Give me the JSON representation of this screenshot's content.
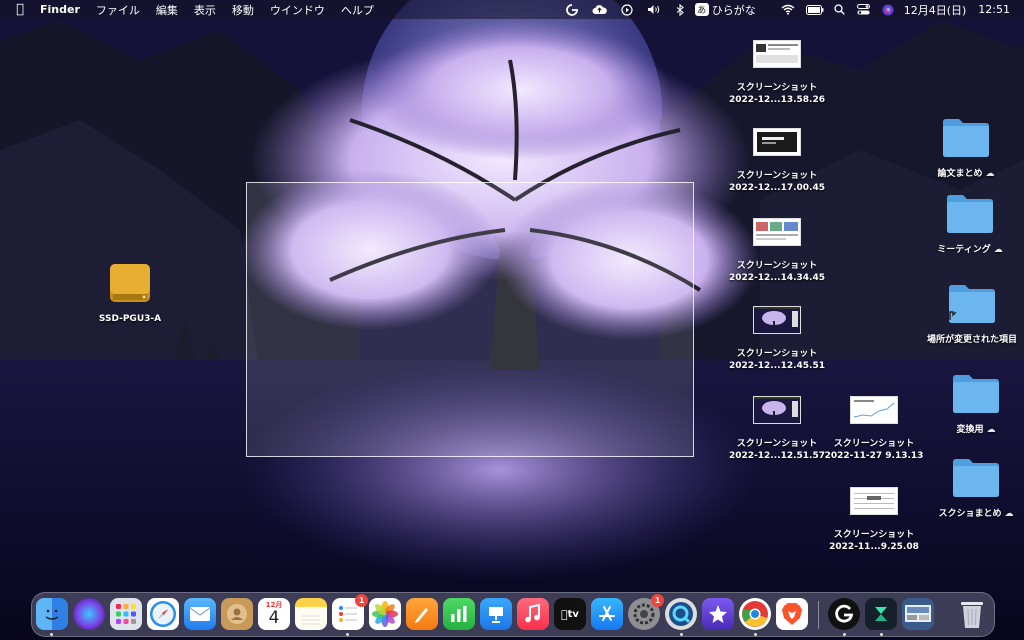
{
  "menubar": {
    "apple_icon": "apple-icon",
    "app_name": "Finder",
    "menus": [
      "ファイル",
      "編集",
      "表示",
      "移動",
      "ウインドウ",
      "ヘルプ"
    ],
    "input_method_badge": "あ",
    "input_method_label": "ひらがな",
    "date": "12月4日(日)",
    "time": "12:51"
  },
  "desktop": {
    "drive": {
      "label": "SSD-PGU3-A"
    },
    "screenshots": [
      {
        "line1": "スクリーンショット",
        "line2": "2022-12...13.58.26"
      },
      {
        "line1": "スクリーンショット",
        "line2": "2022-12...17.00.45"
      },
      {
        "line1": "スクリーンショット",
        "line2": "2022-12...14.34.45"
      },
      {
        "line1": "スクリーンショット",
        "line2": "2022-12...12.45.51"
      },
      {
        "line1": "スクリーンショット",
        "line2": "2022-12...12.51.57"
      },
      {
        "line1": "スクリーンショット",
        "line2": "2022-11-27 9.13.13"
      },
      {
        "line1": "スクリーンショット",
        "line2": "2022-11...9.25.08"
      }
    ],
    "folders": [
      {
        "label": "論文まとめ"
      },
      {
        "label": "ミーティング"
      },
      {
        "label": "場所が変更された項目"
      },
      {
        "label": "変換用"
      },
      {
        "label": "スクショまとめ"
      }
    ]
  },
  "dock": {
    "calendar_month": "12月",
    "calendar_day": "4",
    "reminders_badge": "1",
    "settings_badge": "1",
    "tv_label": "tv"
  },
  "colors": {
    "folder_blue": "#6cb6f0",
    "badge_red": "#f0453a"
  }
}
